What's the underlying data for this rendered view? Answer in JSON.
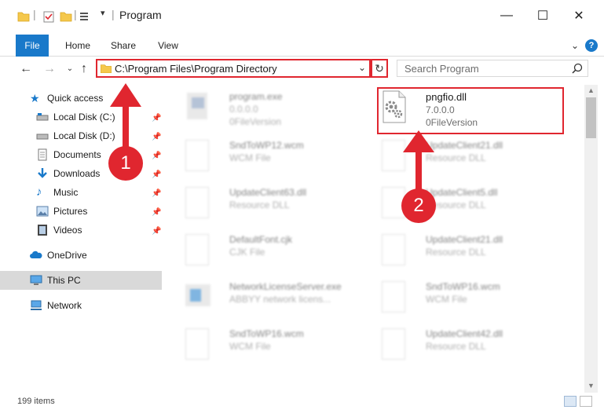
{
  "window": {
    "title": "Program",
    "minimize": "—",
    "maximize": "☐",
    "close": "✕"
  },
  "ribbon": {
    "tabs": [
      "File",
      "Home",
      "Share",
      "View"
    ],
    "help": "?"
  },
  "address": {
    "path": "C:\\Program Files\\Program Directory",
    "search_placeholder": "Search Program"
  },
  "nav": {
    "quick_access": "Quick access",
    "items": [
      {
        "label": "Local Disk (C:)",
        "pinned": true
      },
      {
        "label": "Local Disk (D:)",
        "pinned": true
      },
      {
        "label": "Documents",
        "pinned": true
      },
      {
        "label": "Downloads",
        "pinned": true
      },
      {
        "label": "Music",
        "pinned": true
      },
      {
        "label": "Pictures",
        "pinned": true
      },
      {
        "label": "Videos",
        "pinned": true
      }
    ],
    "onedrive": "OneDrive",
    "this_pc": "This PC",
    "network": "Network"
  },
  "files": [
    {
      "name": "program.exe",
      "sub1": "0.0.0.0",
      "sub2": "0FileVersion",
      "blurred": true
    },
    {
      "name": "pngfio.dll",
      "sub1": "7.0.0.0",
      "sub2": "0FileVersion",
      "blurred": false
    },
    {
      "name": "SndToWP12.wcm",
      "sub1": "WCM File",
      "sub2": "",
      "blurred": true
    },
    {
      "name": "UpdateClient21.dll",
      "sub1": "Resource DLL",
      "sub2": "",
      "blurred": true
    },
    {
      "name": "UpdateClient63.dll",
      "sub1": "Resource DLL",
      "sub2": "",
      "blurred": true
    },
    {
      "name": "UpdateClient5.dll",
      "sub1": "Resource DLL",
      "sub2": "",
      "blurred": true
    },
    {
      "name": "DefaultFont.cjk",
      "sub1": "CJK File",
      "sub2": "",
      "blurred": true
    },
    {
      "name": "UpdateClient21.dll",
      "sub1": "Resource DLL",
      "sub2": "",
      "blurred": true
    },
    {
      "name": "NetworkLicenseServer.exe",
      "sub1": "ABBYY network licens...",
      "sub2": "",
      "blurred": true
    },
    {
      "name": "SndToWP16.wcm",
      "sub1": "WCM File",
      "sub2": "",
      "blurred": true
    },
    {
      "name": "SndToWP16.wcm",
      "sub1": "WCM File",
      "sub2": "",
      "blurred": true
    },
    {
      "name": "UpdateClient42.dll",
      "sub1": "Resource DLL",
      "sub2": "",
      "blurred": true
    }
  ],
  "status": {
    "item_count": "199 items"
  },
  "annotations": {
    "step1": "1",
    "step2": "2"
  },
  "colors": {
    "accent": "#1979ca",
    "annotation": "#e0262f"
  }
}
